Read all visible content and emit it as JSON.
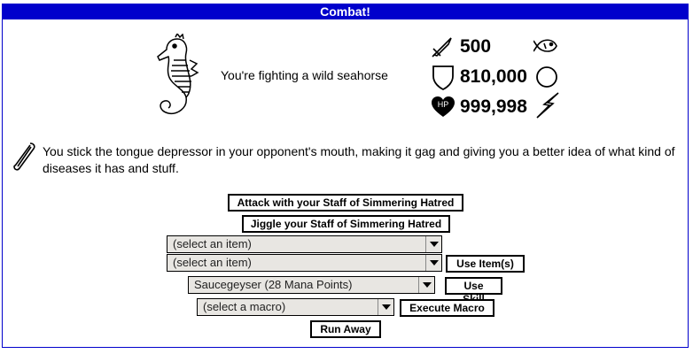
{
  "window": {
    "title": "Combat!"
  },
  "monster": {
    "description": "You're fighting a wild seahorse",
    "image_icon": "seahorse-icon"
  },
  "stats": {
    "attack": {
      "icon": "sword-icon",
      "value": "500"
    },
    "defense": {
      "icon": "shield-icon",
      "value": "810,000"
    },
    "hp": {
      "icon": "heart-hp-icon",
      "value": "999,998",
      "icon_label": "HP"
    },
    "element_icons": [
      "fish-icon",
      "circle-icon",
      "lightning-bolt-icon"
    ]
  },
  "message": {
    "icon": "tongue-depressor-icon",
    "text": "You stick the tongue depressor in your opponent's mouth, making it gag and giving you a better idea of what kind of diseases it has and stuff."
  },
  "actions": {
    "attack_label": "Attack with your Staff of Simmering Hatred",
    "jiggle_label": "Jiggle your Staff of Simmering Hatred",
    "item_select_1": "(select an item)",
    "item_select_2": "(select an item)",
    "use_items_label": "Use Item(s)",
    "skill_select": "Saucegeyser (28 Mana Points)",
    "use_skill_label": "Use Skill",
    "macro_select": "(select a macro)",
    "execute_macro_label": "Execute Macro",
    "run_away_label": "Run Away"
  }
}
